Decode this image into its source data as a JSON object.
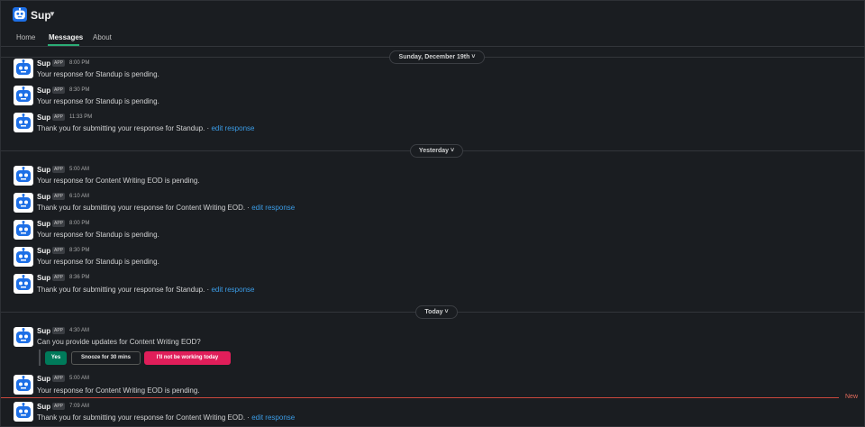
{
  "app": {
    "title": "Sup"
  },
  "tabs": [
    {
      "label": "Home"
    },
    {
      "label": "Messages"
    },
    {
      "label": "About"
    }
  ],
  "dates": [
    "Sunday, December 19th",
    "Yesterday",
    "Today"
  ],
  "app_badge": "APP",
  "link_text": "edit response",
  "messages": [
    {
      "name": "Sup",
      "time": "8:00 PM",
      "text": "Your response for Standup is pending."
    },
    {
      "name": "Sup",
      "time": "8:30 PM",
      "text": "Your response for Standup is pending."
    },
    {
      "name": "Sup",
      "time": "11:33 PM",
      "text": "Thank you for submitting your response for Standup. · "
    },
    {
      "name": "Sup",
      "time": "5:00 AM",
      "text": "Your response for Content Writing EOD is pending."
    },
    {
      "name": "Sup",
      "time": "6:10 AM",
      "text": "Thank you for submitting your response for Content Writing EOD. · "
    },
    {
      "name": "Sup",
      "time": "8:00 PM",
      "text": "Your response for Standup is pending."
    },
    {
      "name": "Sup",
      "time": "8:30 PM",
      "text": "Your response for Standup is pending."
    },
    {
      "name": "Sup",
      "time": "8:36 PM",
      "text": "Thank you for submitting your response for Standup. · "
    },
    {
      "name": "Sup",
      "time": "4:30 AM",
      "text": "Can you provide updates for Content Writing EOD?"
    },
    {
      "name": "Sup",
      "time": "5:00 AM",
      "text": "Your response for Content Writing EOD is pending."
    },
    {
      "name": "Sup",
      "time": "7:09 AM",
      "text": "Thank you for submitting your response for Content Writing EOD. · "
    }
  ],
  "buttons": {
    "yes": "Yes",
    "snooze": "Snooze for 30 mins",
    "no": "I'll not be working today"
  },
  "new_label": "New",
  "colors": {
    "background": "#1a1d21",
    "link": "#3b9ce6",
    "yes": "#007a5a",
    "no": "#e01e5a",
    "new": "#e46b5c",
    "bot": "#1d6fe6"
  }
}
